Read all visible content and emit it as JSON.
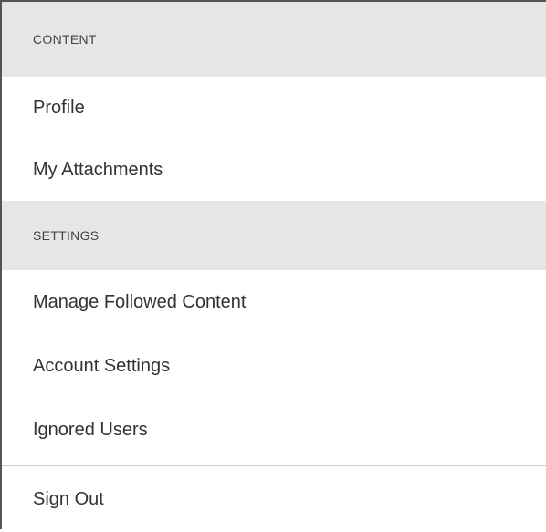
{
  "menu": {
    "sections": [
      {
        "header": "CONTENT",
        "items": [
          "Profile",
          "My Attachments"
        ]
      },
      {
        "header": "SETTINGS",
        "items": [
          "Manage Followed Content",
          "Account Settings",
          "Ignored Users"
        ]
      }
    ],
    "footer_item": "Sign Out"
  },
  "colors": {
    "section_header_bg": "#e6e6e6",
    "text": "#333333",
    "border": "#555555",
    "divider": "#cfcfcf"
  }
}
